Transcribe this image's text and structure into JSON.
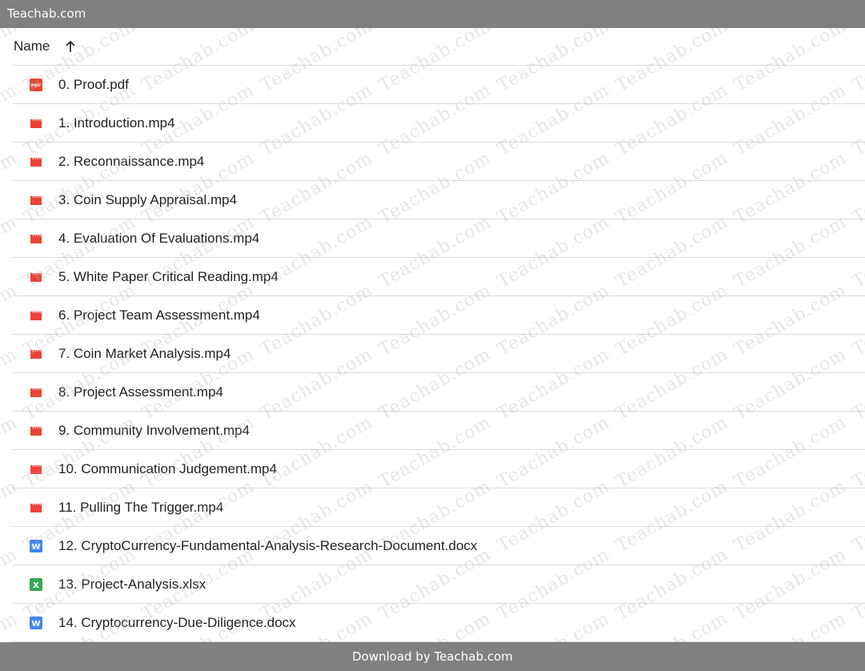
{
  "topbar": {
    "title": "Teachab.com"
  },
  "header": {
    "name_label": "Name",
    "sort_icon": "arrow-up-icon"
  },
  "files": [
    {
      "name": "0. Proof.pdf",
      "type": "pdf",
      "icon": "pdf-icon"
    },
    {
      "name": "1. Introduction.mp4",
      "type": "video",
      "icon": "video-icon"
    },
    {
      "name": "2. Reconnaissance.mp4",
      "type": "video",
      "icon": "video-icon"
    },
    {
      "name": "3. Coin Supply Appraisal.mp4",
      "type": "video",
      "icon": "video-icon"
    },
    {
      "name": "4. Evaluation Of Evaluations.mp4",
      "type": "video",
      "icon": "video-icon"
    },
    {
      "name": "5. White Paper Critical Reading.mp4",
      "type": "video",
      "icon": "video-icon"
    },
    {
      "name": "6. Project Team Assessment.mp4",
      "type": "video",
      "icon": "video-icon"
    },
    {
      "name": "7. Coin Market Analysis.mp4",
      "type": "video",
      "icon": "video-icon"
    },
    {
      "name": "8. Project Assessment.mp4",
      "type": "video",
      "icon": "video-icon"
    },
    {
      "name": "9. Community Involvement.mp4",
      "type": "video",
      "icon": "video-icon"
    },
    {
      "name": "10. Communication Judgement.mp4",
      "type": "video",
      "icon": "video-icon"
    },
    {
      "name": "11. Pulling The Trigger.mp4",
      "type": "video",
      "icon": "video-icon"
    },
    {
      "name": "12. CryptoCurrency-Fundamental-Analysis-Research-Document.docx",
      "type": "doc",
      "icon": "word-icon"
    },
    {
      "name": "13. Project-Analysis.xlsx",
      "type": "sheet",
      "icon": "excel-icon"
    },
    {
      "name": "14. Cryptocurrency-Due-Diligence.docx",
      "type": "doc",
      "icon": "word-icon"
    }
  ],
  "watermark": {
    "text": "Teachab.com"
  },
  "bottombar": {
    "text": "Download by Teachab.com"
  },
  "colors": {
    "bar_background": "#808080",
    "pdf": "#ea4335",
    "video": "#ea4335",
    "doc": "#4285f4",
    "sheet": "#34a853",
    "divider": "#dadce0"
  }
}
